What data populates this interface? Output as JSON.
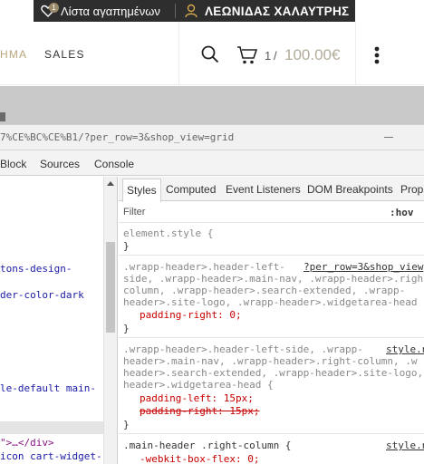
{
  "site": {
    "wishlist_label": "Λίστα αγαπημένων",
    "wishlist_count": "1",
    "user_name": "ΛΕΩΝΙΔΑΣ ΧΑΛΑΥΤΡΗΣ",
    "nav_partial": "ΗΜΑ",
    "nav_sales": "SALES",
    "cart_count": "1",
    "cart_sep": "/",
    "cart_total": "100.00€",
    "accent_color": "#b8a57a"
  },
  "devtools": {
    "url": "7%CE%BC%CE%B1/?per_row=3&shop_view=grid",
    "tabs": [
      "Block",
      "Sources",
      "Console"
    ],
    "elements": [
      "tons-design-",
      "der-color-dark",
      "le-default main-",
      "\">…</div>",
      "icon cart-widget-"
    ],
    "styles_tabs": [
      "Styles",
      "Computed",
      "Event Listeners",
      "DOM Breakpoints",
      "Prop"
    ],
    "filter_label": "Filter",
    "hov_label": ":hov",
    "rules": {
      "r1_selector": "element.style {",
      "r1_close": "}",
      "r2_sel1": ".wrapp-header>.header-left-",
      "r2_src": "?per_row=3&shop_view",
      "r2_sel2": "side, .wrapp-header>.main-nav, .wrapp-header>.righ",
      "r2_sel3": "column, .wrapp-header>.search-extended, .wrapp-",
      "r2_sel4": "header>.site-logo, .wrapp-header>.widgetarea-head {",
      "r2_prop": "padding-right: 0;",
      "r2_close": "}",
      "r3_sel1": ".wrapp-header>.header-left-side, .wrapp-",
      "r3_src": "style.n",
      "r3_sel2": "header>.main-nav, .wrapp-header>.right-column, .w",
      "r3_sel3": "header>.search-extended, .wrapp-header>.site-logo,",
      "r3_sel4": "header>.widgetarea-head {",
      "r3_prop1": "padding-left: 15px;",
      "r3_prop2": "padding-right: 15px;",
      "r3_close": "}",
      "r4_sel": ".main-header .right-column {",
      "r4_src": "style.n",
      "r4_prop": "-webkit-box-flex: 0;"
    }
  }
}
